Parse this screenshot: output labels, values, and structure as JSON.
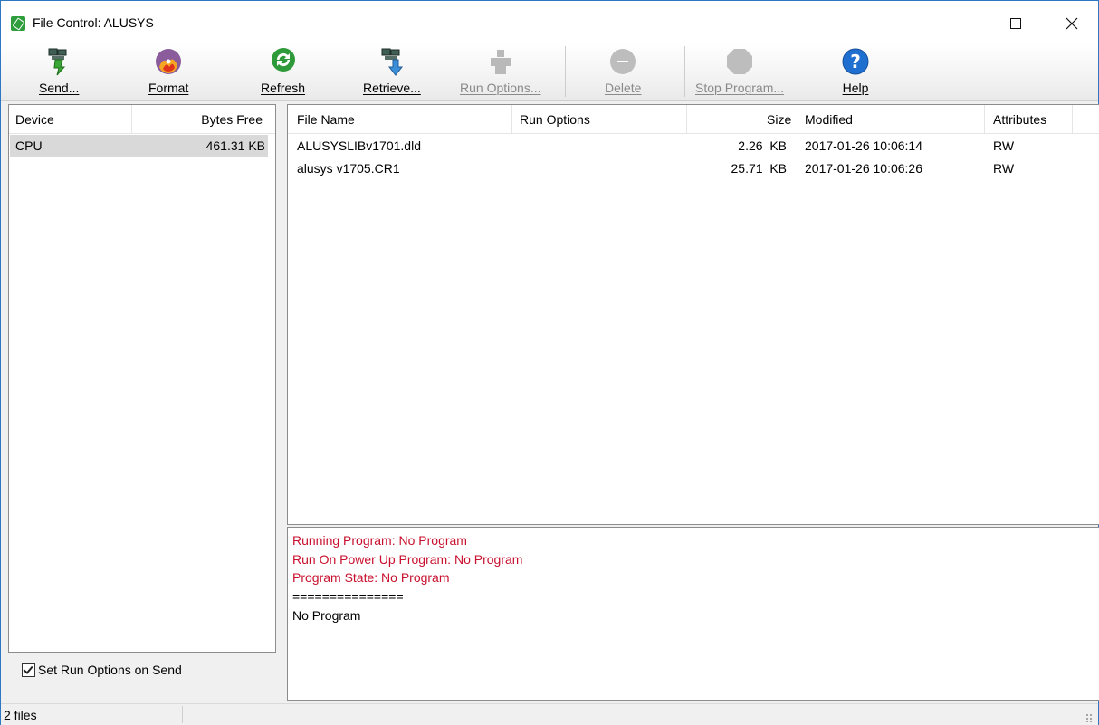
{
  "window": {
    "title": "File Control: ALUSYS"
  },
  "toolbar": {
    "send": "Send...",
    "format": "Format",
    "refresh": "Refresh",
    "retrieve": "Retrieve...",
    "run_options": "Run Options...",
    "delete": "Delete",
    "stop_program": "Stop Program...",
    "help": "Help"
  },
  "devices": {
    "headers": {
      "device": "Device",
      "bytes_free": "Bytes Free"
    },
    "rows": [
      {
        "device": "CPU",
        "bytes_free": "461.31 KB"
      }
    ]
  },
  "options": {
    "set_run_options_on_send": "Set Run Options on Send",
    "checked": true
  },
  "files": {
    "headers": {
      "name": "File Name",
      "run_options": "Run Options",
      "size": "Size",
      "modified": "Modified",
      "attributes": "Attributes"
    },
    "rows": [
      {
        "name": "ALUSYSLIBv1701.dld",
        "run_options": "",
        "size": "2.26  KB",
        "modified": "2017-01-26 10:06:14",
        "attributes": "RW"
      },
      {
        "name": "alusys v1705.CR1",
        "run_options": "",
        "size": "25.71  KB",
        "modified": "2017-01-26 10:06:26",
        "attributes": "RW"
      }
    ]
  },
  "output": {
    "running_program": "Running Program: No Program",
    "run_on_power_up": "Run On Power Up Program: No Program",
    "program_state": "Program State: No Program",
    "divider": "===============",
    "program": "No Program"
  },
  "status": {
    "text": "2 files"
  },
  "colors": {
    "output_status_red": "#c8102e",
    "selection_gray": "#d9d9d9",
    "title_icon_green": "#2e9d3c"
  }
}
